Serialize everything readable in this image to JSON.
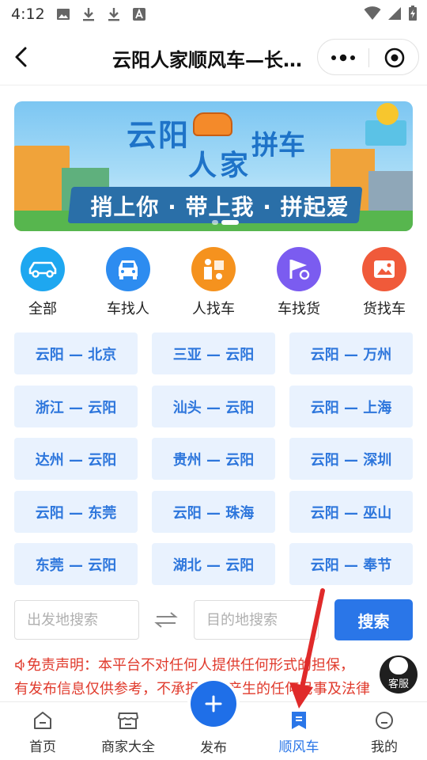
{
  "status_bar": {
    "time": "4:12",
    "icons": [
      "image-icon",
      "download-icon",
      "download-icon",
      "font-icon"
    ],
    "right_icons": [
      "wifi-icon",
      "signal-icon",
      "battery-charging-icon"
    ]
  },
  "header": {
    "title": "云阳人家顺风车—长…"
  },
  "banner": {
    "title_1": "云阳",
    "title_2": "人家",
    "title_3": "拼车",
    "slogan": "捎上你 · 带上我 · 拼起爱",
    "slide_count": 2,
    "active_slide": 1
  },
  "categories": [
    {
      "label": "全部",
      "icon": "car-outline-icon",
      "color": "#1ea7f0"
    },
    {
      "label": "车找人",
      "icon": "car-front-icon",
      "color": "#2d8cf0"
    },
    {
      "label": "人找车",
      "icon": "person-flag-icon",
      "color": "#f5921e"
    },
    {
      "label": "车找货",
      "icon": "flag-location-icon",
      "color": "#7b5cf0"
    },
    {
      "label": "货找车",
      "icon": "image-frame-icon",
      "color": "#f05a3a"
    }
  ],
  "routes": [
    "云阳 — 北京",
    "三亚 — 云阳",
    "云阳 — 万州",
    "浙江 — 云阳",
    "汕头 — 云阳",
    "云阳 — 上海",
    "达州 — 云阳",
    "贵州 — 云阳",
    "云阳 — 深圳",
    "云阳 — 东莞",
    "云阳 — 珠海",
    "云阳 — 巫山",
    "东莞 — 云阳",
    "湖北 — 云阳",
    "云阳 — 奉节"
  ],
  "search": {
    "from_placeholder": "出发地搜索",
    "to_placeholder": "目的地搜索",
    "button_label": "搜索"
  },
  "disclaimer": {
    "line_1": "免责声明：本平台不对任何人提供任何形式的担保，",
    "line_2": "有发布信息仅供参考，不承担因此产生的任何民事及法律"
  },
  "customer_service": {
    "label": "客服"
  },
  "tabbar": {
    "items": [
      {
        "label": "首页",
        "icon": "home-icon"
      },
      {
        "label": "商家大全",
        "icon": "shop-icon"
      },
      {
        "label": "发布",
        "icon": "plus-icon"
      },
      {
        "label": "顺风车",
        "icon": "bookmark-icon"
      },
      {
        "label": "我的",
        "icon": "smile-icon"
      }
    ],
    "active_index": 3
  },
  "colors": {
    "accent": "#2a76e8",
    "route_bg": "#e9f2fe",
    "route_text": "#2d76dc",
    "disclaimer": "#e03a2c",
    "annotation_arrow": "#e02a2a"
  }
}
